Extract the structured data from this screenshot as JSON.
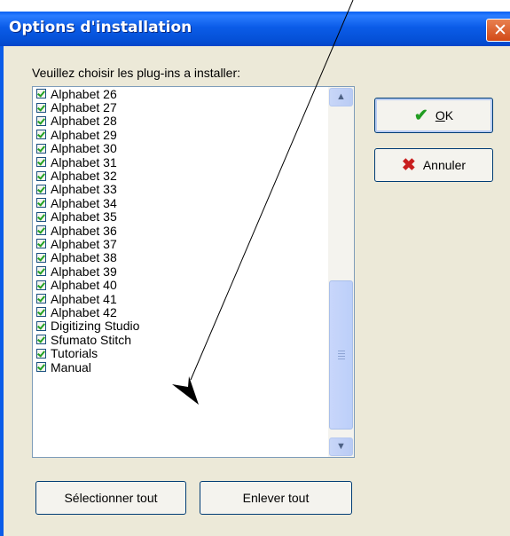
{
  "window": {
    "title": "Options d'installation",
    "close_glyph": "✕",
    "titlebar_color": "#0b5ce8"
  },
  "prompt": "Veuillez choisir les plug-ins a installer:",
  "plugins": [
    {
      "label": "Alphabet 26",
      "checked": true
    },
    {
      "label": "Alphabet 27",
      "checked": true
    },
    {
      "label": "Alphabet 28",
      "checked": true
    },
    {
      "label": "Alphabet 29",
      "checked": true
    },
    {
      "label": "Alphabet 30",
      "checked": true
    },
    {
      "label": "Alphabet 31",
      "checked": true
    },
    {
      "label": "Alphabet 32",
      "checked": true
    },
    {
      "label": "Alphabet 33",
      "checked": true
    },
    {
      "label": "Alphabet 34",
      "checked": true
    },
    {
      "label": "Alphabet 35",
      "checked": true
    },
    {
      "label": "Alphabet 36",
      "checked": true
    },
    {
      "label": "Alphabet 37",
      "checked": true
    },
    {
      "label": "Alphabet 38",
      "checked": true
    },
    {
      "label": "Alphabet 39",
      "checked": true
    },
    {
      "label": "Alphabet 40",
      "checked": true
    },
    {
      "label": "Alphabet 41",
      "checked": true
    },
    {
      "label": "Alphabet 42",
      "checked": true
    },
    {
      "label": "Digitizing Studio",
      "checked": true
    },
    {
      "label": "Sfumato Stitch",
      "checked": true
    },
    {
      "label": "Tutorials",
      "checked": true
    },
    {
      "label": "Manual",
      "checked": true
    }
  ],
  "buttons": {
    "ok_mnemonic": "O",
    "ok_rest": "K",
    "cancel": "Annuler",
    "select_all": "Sélectionner tout",
    "remove_all": "Enlever tout"
  },
  "icons": {
    "ok": "check-icon",
    "cancel": "x-icon",
    "scroll_up": "chevron-up-icon",
    "scroll_down": "chevron-down-icon"
  },
  "colors": {
    "checkmark": "#21a121",
    "cancel_x": "#c81e1e",
    "close_button": "#d24a17"
  }
}
